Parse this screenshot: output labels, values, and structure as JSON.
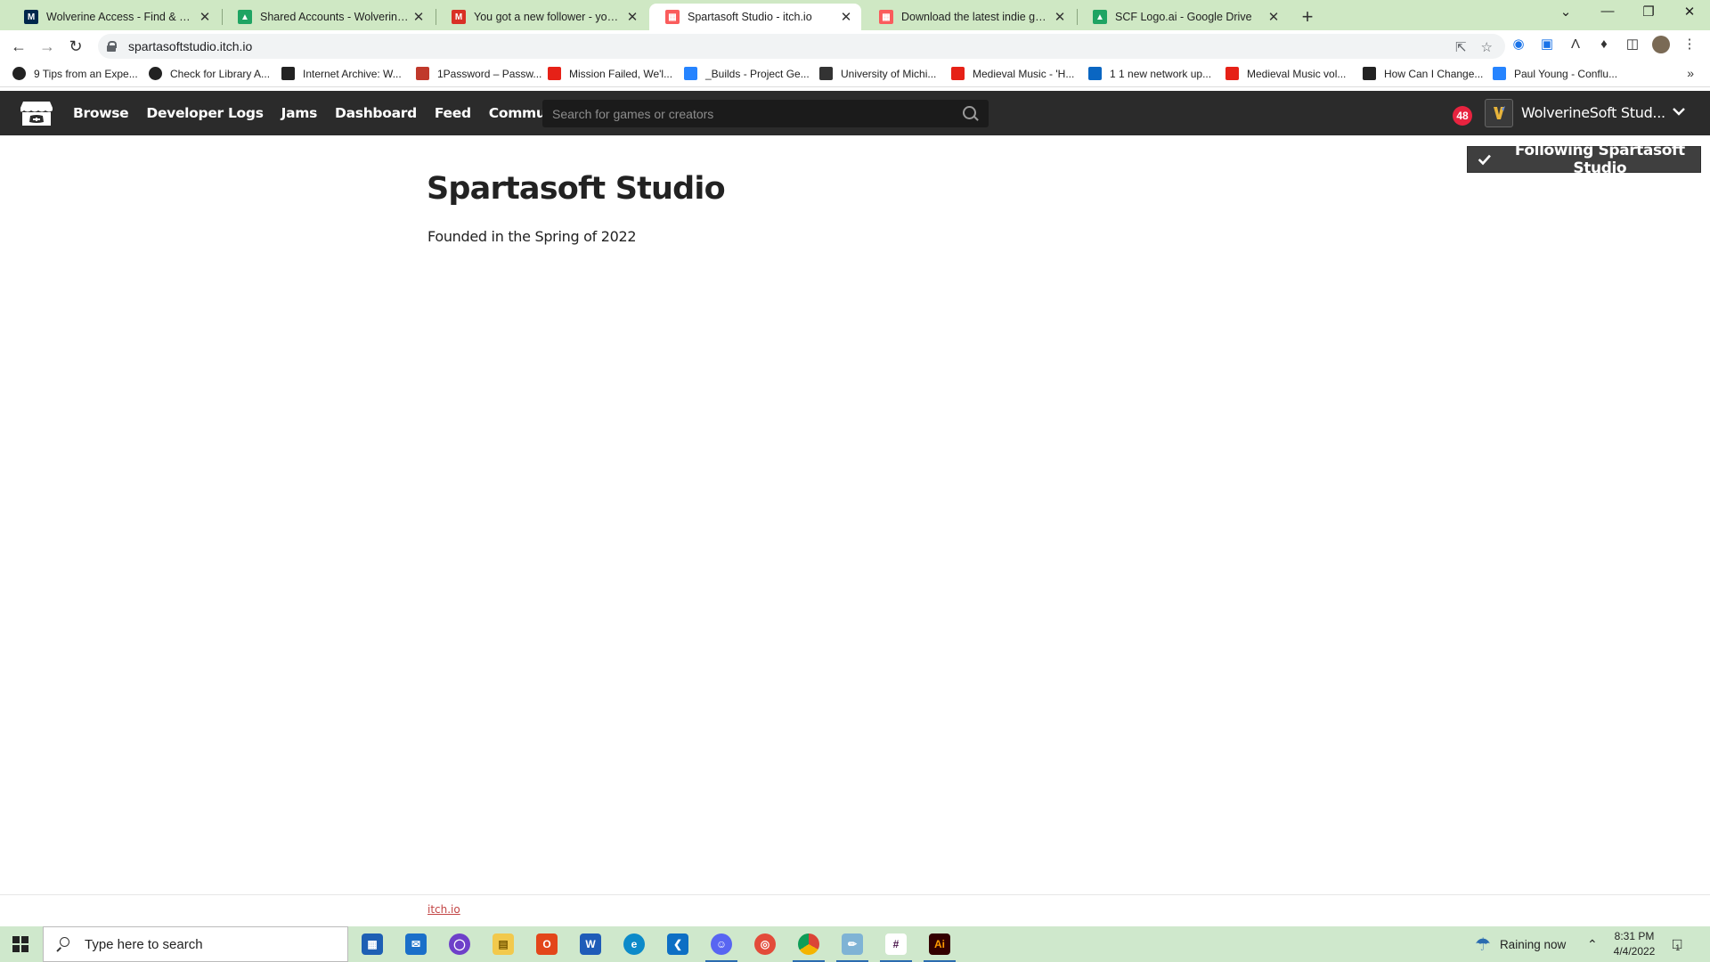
{
  "browser": {
    "tabs": [
      {
        "title": "Wolverine Access - Find & Favorites",
        "favicon": "michigan-m-icon",
        "color": "#00274c"
      },
      {
        "title": "Shared Accounts - WolverineSoft",
        "favicon": "google-drive-icon",
        "color": "#1fa463"
      },
      {
        "title": "You got a new follower - youngp",
        "favicon": "gmail-icon",
        "color": "#d93025"
      },
      {
        "title": "Spartasoft Studio - itch.io",
        "favicon": "itchio-icon",
        "color": "#fa5c5c",
        "active": true
      },
      {
        "title": "Download the latest indie games",
        "favicon": "itchio-icon",
        "color": "#fa5c5c"
      },
      {
        "title": "SCF Logo.ai - Google Drive",
        "favicon": "google-drive-icon",
        "color": "#1fa463"
      }
    ],
    "url": "spartasoftstudio.itch.io",
    "bookmarks": [
      {
        "label": "9 Tips from an Expe...",
        "icon": "globe-icon",
        "color": "#222"
      },
      {
        "label": "Check for Library A...",
        "icon": "globe-icon",
        "color": "#222"
      },
      {
        "label": "Internet Archive: W...",
        "icon": "archive-icon",
        "color": "#222"
      },
      {
        "label": "1Password – Passw...",
        "icon": "1password-icon",
        "color": "#c0392b"
      },
      {
        "label": "Mission Failed, We'l...",
        "icon": "youtube-icon",
        "color": "#e62117"
      },
      {
        "label": "_Builds - Project Ge...",
        "icon": "confluence-icon",
        "color": "#2684ff"
      },
      {
        "label": "University of Michi...",
        "icon": "cube-icon",
        "color": "#333"
      },
      {
        "label": "Medieval Music - 'H...",
        "icon": "youtube-icon",
        "color": "#e62117"
      },
      {
        "label": "1 1 new network up...",
        "icon": "linkedin-icon",
        "color": "#0a66c2"
      },
      {
        "label": "Medieval Music vol...",
        "icon": "youtube-icon",
        "color": "#e62117"
      },
      {
        "label": "How Can I Change...",
        "icon": "wikipedia-icon",
        "color": "#222"
      },
      {
        "label": "Paul Young - Conflu...",
        "icon": "confluence-icon",
        "color": "#2684ff"
      }
    ]
  },
  "itch": {
    "nav": [
      "Browse",
      "Developer Logs",
      "Jams",
      "Dashboard",
      "Feed",
      "Community"
    ],
    "search_placeholder": "Search for games or creators",
    "notification_count": "48",
    "user_name": "WolverineSoft Stud...",
    "accent": "#fa5c5c"
  },
  "page": {
    "follow_label": "Following Spartasoft Studio",
    "title": "Spartasoft Studio",
    "description": "Founded in the Spring of 2022",
    "footer_link": "itch.io"
  },
  "taskbar": {
    "search_placeholder": "Type here to search",
    "weather": "Raining now",
    "time": "8:31 PM",
    "date": "4/4/2022",
    "notification_count": "1"
  }
}
